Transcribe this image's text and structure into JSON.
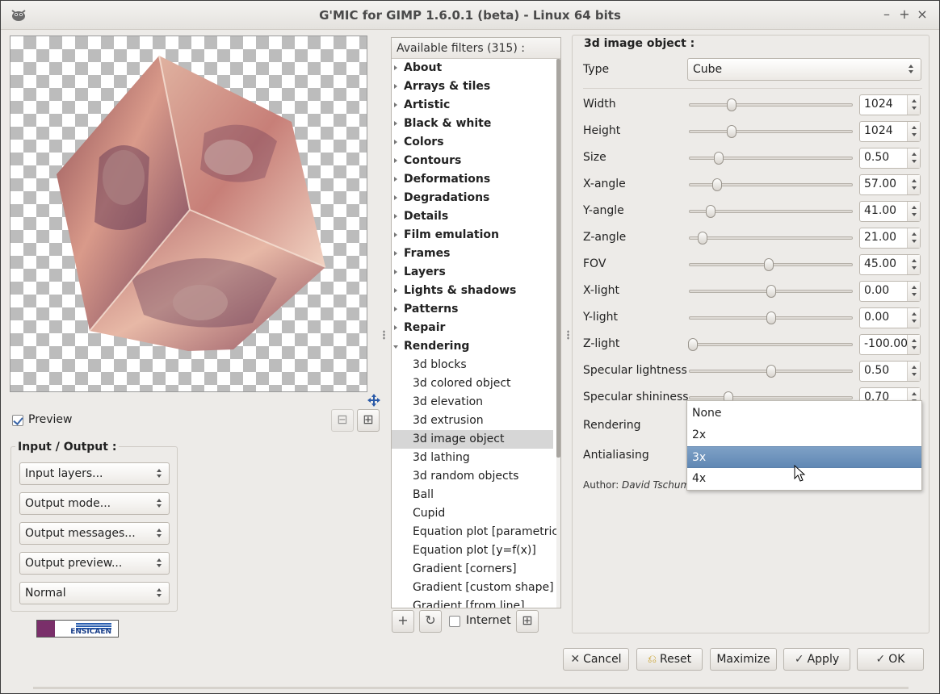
{
  "window": {
    "title": "G'MIC for GIMP 1.6.0.1 (beta) - Linux 64 bits",
    "controls": {
      "minimize": "–",
      "maximize": "+",
      "close": "×"
    }
  },
  "preview": {
    "checkbox_label": "Preview",
    "checked": true
  },
  "io": {
    "title": "Input / Output :",
    "input_layers": "Input layers...",
    "output_mode": "Output mode...",
    "output_messages": "Output messages...",
    "output_preview": "Output preview...",
    "blend_mode": "Normal"
  },
  "logo": {
    "text": "ENSICAEN",
    "badge": "CIR"
  },
  "filters": {
    "header": "Available filters (315) :",
    "categories": [
      "About",
      "Arrays & tiles",
      "Artistic",
      "Black & white",
      "Colors",
      "Contours",
      "Deformations",
      "Degradations",
      "Details",
      "Film emulation",
      "Frames",
      "Layers",
      "Lights & shadows",
      "Patterns",
      "Repair",
      "Rendering"
    ],
    "rendering_items": [
      "3d blocks",
      "3d colored object",
      "3d elevation",
      "3d extrusion",
      "3d image object",
      "3d lathing",
      "3d random objects",
      "Ball",
      "Cupid",
      "Equation plot [parametric]",
      "Equation plot [y=f(x)]",
      "Gradient [corners]",
      "Gradient [custom shape]",
      "Gradient [from line]"
    ],
    "selected": "3d image object",
    "internet_label": "Internet",
    "internet_checked": false
  },
  "settings": {
    "title": "3d image object :",
    "type_label": "Type",
    "type_value": "Cube",
    "params": [
      {
        "label": "Width",
        "value": "1024",
        "level": 0.26
      },
      {
        "label": "Height",
        "value": "1024",
        "level": 0.26
      },
      {
        "label": "Size",
        "value": "0.50",
        "level": 0.18
      },
      {
        "label": "X-angle",
        "value": "57.00",
        "level": 0.17
      },
      {
        "label": "Y-angle",
        "value": "41.00",
        "level": 0.13
      },
      {
        "label": "Z-angle",
        "value": "21.00",
        "level": 0.08
      },
      {
        "label": "FOV",
        "value": "45.00",
        "level": 0.49
      },
      {
        "label": "X-light",
        "value": "0.00",
        "level": 0.5
      },
      {
        "label": "Y-light",
        "value": "0.00",
        "level": 0.5
      },
      {
        "label": "Z-light",
        "value": "-100.00",
        "level": 0.02
      },
      {
        "label": "Specular lightness",
        "value": "0.50",
        "level": 0.5
      },
      {
        "label": "Specular shininess",
        "value": "0.70",
        "level": 0.24
      }
    ],
    "rendering_label": "Rendering",
    "antialiasing_label": "Antialiasing",
    "author_prefix": "Author: ",
    "author_name": "David Tschump",
    "dropdown_options": [
      "None",
      "2x",
      "3x",
      "4x"
    ],
    "dropdown_highlighted": "3x"
  },
  "buttons": {
    "cancel": "Cancel",
    "reset": "Reset",
    "maximize": "Maximize",
    "apply": "Apply",
    "ok": "OK"
  },
  "colors": {
    "accent": "#6a8fba",
    "window_bg": "#edebe8",
    "cube_tint": "#c9867a"
  }
}
